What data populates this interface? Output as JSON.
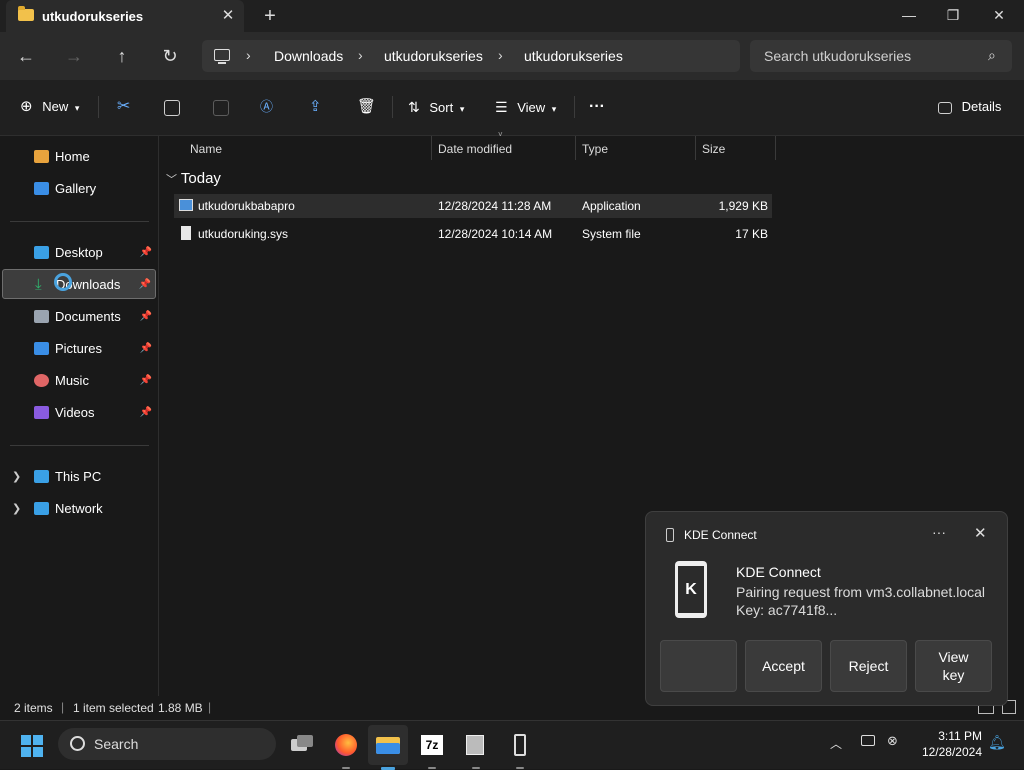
{
  "window": {
    "tab_title": "utkudorukseries",
    "icons": [
      "folder-icon",
      "close-icon",
      "plus-icon",
      "minimize-icon",
      "maximize-icon",
      "close-icon"
    ]
  },
  "nav": {
    "breadcrumbs": [
      "Downloads",
      "utkudorukseries",
      "utkudorukseries"
    ],
    "search_placeholder": "Search utkudorukseries"
  },
  "commands": {
    "new": "New",
    "sort": "Sort",
    "view": "View",
    "details": "Details"
  },
  "sidebar": {
    "items": [
      {
        "label": "Home",
        "color": "#e8a33d"
      },
      {
        "label": "Gallery",
        "color": "#3a8ee6"
      },
      {
        "label": "Desktop",
        "color": "#3aa0e6"
      },
      {
        "label": "Downloads",
        "color": "#2fb36d"
      },
      {
        "label": "Documents",
        "color": "#9aa4b0"
      },
      {
        "label": "Pictures",
        "color": "#3a8ee6"
      },
      {
        "label": "Music",
        "color": "#e06666"
      },
      {
        "label": "Videos",
        "color": "#8a5be0"
      },
      {
        "label": "This PC",
        "color": "#3aa0e6"
      },
      {
        "label": "Network",
        "color": "#3aa0e6"
      }
    ]
  },
  "filelist": {
    "columns": [
      "Name",
      "Date modified",
      "Type",
      "Size"
    ],
    "group": "Today",
    "rows": [
      {
        "name": "utkudorukbabapro",
        "date": "12/28/2024 11:28 AM",
        "type": "Application",
        "size": "1,929 KB"
      },
      {
        "name": "utkudoruking.sys",
        "date": "12/28/2024 10:14 AM",
        "type": "System file",
        "size": "17 KB"
      }
    ]
  },
  "status": {
    "count": "2 items",
    "selection": "1 item selected",
    "size": "1.88 MB"
  },
  "toast": {
    "app": "KDE Connect",
    "title": "KDE Connect",
    "body_line1": "Pairing request from vm3.collabnet.local",
    "body_line2": "Key: ac7741f8...",
    "btn_accept": "Accept",
    "btn_reject": "Reject",
    "btn_viewkey": "View key"
  },
  "taskbar": {
    "search": "Search",
    "time": "3:11 PM",
    "date": "12/28/2024",
    "app_7zip": "7z"
  },
  "colors": {
    "accent": "#4aa3df",
    "folder": "#f2c14b"
  }
}
